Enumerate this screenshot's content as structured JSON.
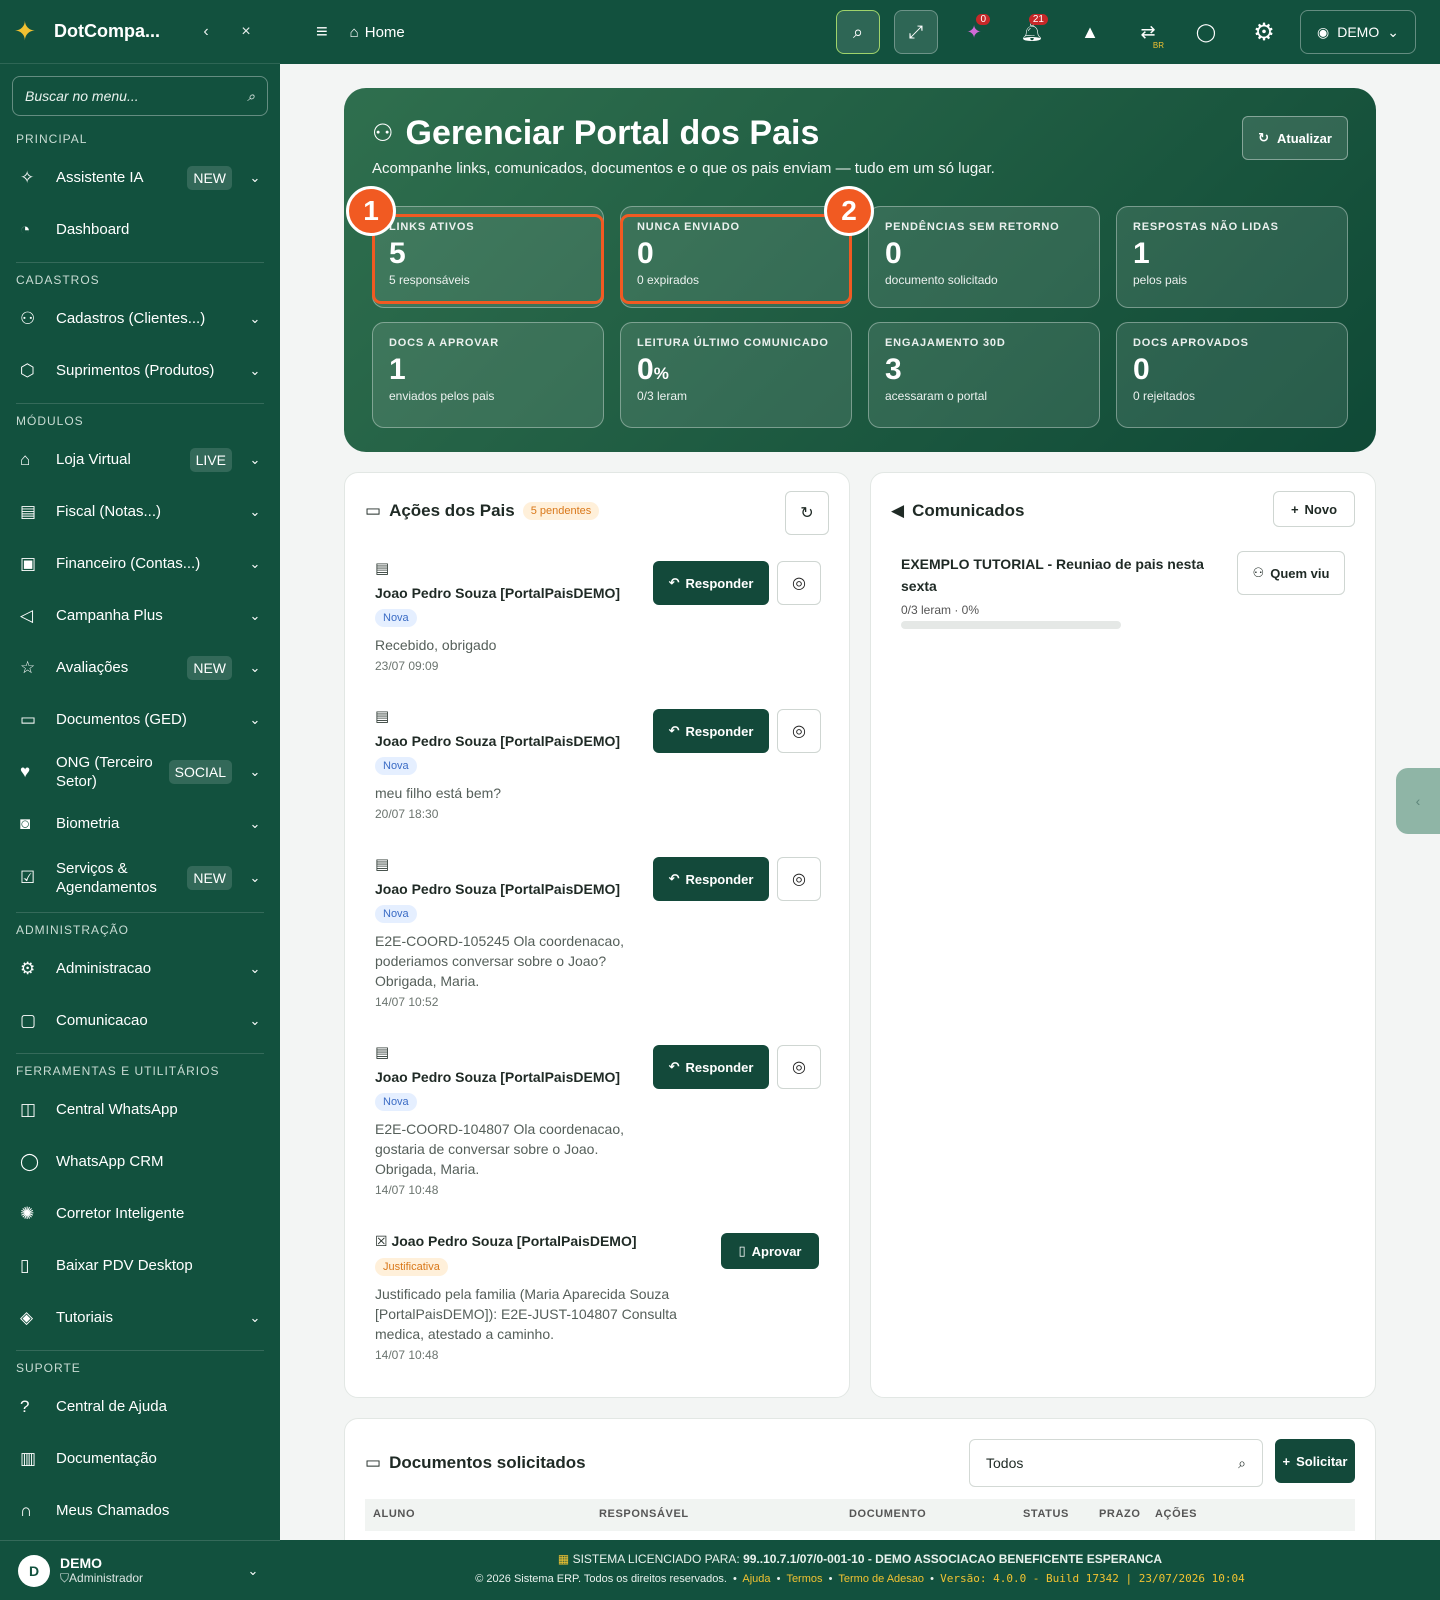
{
  "sidebar": {
    "brand": "DotCompa...",
    "search_placeholder": "Buscar no menu...",
    "sections": {
      "principal": "PRINCIPAL",
      "cadastros": "CADASTROS",
      "modulos": "MÓDULOS",
      "admin": "ADMINISTRAÇÃO",
      "ferramentas": "FERRAMENTAS E UTILITÁRIOS",
      "suporte": "SUPORTE"
    },
    "items": {
      "assistente": {
        "label": "Assistente IA",
        "badge": "NEW"
      },
      "dashboard": {
        "label": "Dashboard"
      },
      "cadastros": {
        "label": "Cadastros (Clientes...)"
      },
      "suprimentos": {
        "label": "Suprimentos (Produtos)"
      },
      "loja": {
        "label": "Loja Virtual",
        "badge": "LIVE"
      },
      "fiscal": {
        "label": "Fiscal (Notas...)"
      },
      "financeiro": {
        "label": "Financeiro (Contas...)"
      },
      "campanha": {
        "label": "Campanha Plus"
      },
      "avaliacoes": {
        "label": "Avaliações",
        "badge": "NEW"
      },
      "documentos": {
        "label": "Documentos (GED)"
      },
      "ong": {
        "label": "ONG (Terceiro Setor)",
        "badge": "SOCIAL"
      },
      "biometria": {
        "label": "Biometria"
      },
      "servicos": {
        "label": "Serviços & Agendamentos",
        "badge": "NEW"
      },
      "administracao": {
        "label": "Administracao"
      },
      "comunicacao": {
        "label": "Comunicacao"
      },
      "central_whatsapp": {
        "label": "Central WhatsApp"
      },
      "whatsapp_crm": {
        "label": "WhatsApp CRM"
      },
      "corretor": {
        "label": "Corretor Inteligente"
      },
      "pdv": {
        "label": "Baixar PDV Desktop"
      },
      "tutoriais": {
        "label": "Tutoriais"
      },
      "ajuda": {
        "label": "Central de Ajuda"
      },
      "documentacao": {
        "label": "Documentação"
      },
      "chamados": {
        "label": "Meus Chamados"
      }
    },
    "user": {
      "initial": "D",
      "name": "DEMO",
      "role": "Administrador"
    }
  },
  "topbar": {
    "home": "Home",
    "ai_count": "0",
    "notif_count": "21",
    "lang_badge": "BR",
    "user": "DEMO"
  },
  "hero": {
    "title": "Gerenciar Portal dos Pais",
    "subtitle": "Acompanhe links, comunicados, documentos e o que os pais enviam — tudo em um só lugar.",
    "refresh": "Atualizar",
    "stats": [
      {
        "label": "LINKS ATIVOS",
        "value": "5",
        "sub": "5 responsáveis"
      },
      {
        "label": "NUNCA ENVIADO",
        "value": "0",
        "sub": "0 expirados"
      },
      {
        "label": "PENDÊNCIAS SEM RETORNO",
        "value": "0",
        "sub": "documento solicitado"
      },
      {
        "label": "RESPOSTAS NÃO LIDAS",
        "value": "1",
        "sub": "pelos pais"
      },
      {
        "label": "DOCS A APROVAR",
        "value": "1",
        "sub": "enviados pelos pais"
      },
      {
        "label": "LEITURA ÚLTIMO COMUNICADO",
        "value": "0",
        "unit": "%",
        "sub": "0/3 leram"
      },
      {
        "label": "ENGAJAMENTO 30D",
        "value": "3",
        "sub": "acessaram o portal"
      },
      {
        "label": "DOCS APROVADOS",
        "value": "0",
        "sub": "0 rejeitados"
      }
    ],
    "markers": [
      "1",
      "2"
    ]
  },
  "acoes": {
    "title": "Ações dos Pais",
    "pending": "5 pendentes",
    "reply": "Responder",
    "approve": "Aprovar",
    "items": [
      {
        "name": "Joao Pedro Souza [PortalPaisDEMO]",
        "tag": "Nova",
        "msg": "Recebido, obrigado",
        "date": "23/07 09:09"
      },
      {
        "name": "Joao Pedro Souza [PortalPaisDEMO]",
        "tag": "Nova",
        "msg": "meu filho está bem?",
        "date": "20/07 18:30"
      },
      {
        "name": "Joao Pedro Souza [PortalPaisDEMO]",
        "tag": "Nova",
        "msg": "E2E-COORD-105245 Ola coordenacao, poderiamos conversar sobre o Joao? Obrigada, Maria.",
        "date": "14/07 10:52"
      },
      {
        "name": "Joao Pedro Souza [PortalPaisDEMO]",
        "tag": "Nova",
        "msg": "E2E-COORD-104807 Ola coordenacao, gostaria de conversar sobre o Joao. Obrigada, Maria.",
        "date": "14/07 10:48"
      },
      {
        "name": "Joao Pedro Souza [PortalPaisDEMO]",
        "tag": "Justificativa",
        "msg": "Justificado pela familia (Maria Aparecida Souza [PortalPaisDEMO]): E2E-JUST-104807 Consulta medica, atestado a caminho.",
        "date": "14/07 10:48"
      }
    ]
  },
  "comunicados": {
    "title": "Comunicados",
    "new": "Novo",
    "item": {
      "title": "EXEMPLO TUTORIAL - Reuniao de pais nesta sexta",
      "meta": "0/3 leram · 0%",
      "who": "Quem viu",
      "progress": 0
    }
  },
  "documentos": {
    "title": "Documentos solicitados",
    "filter": "Todos",
    "request": "Solicitar",
    "columns": [
      "ALUNO",
      "RESPONSÁVEL",
      "DOCUMENTO",
      "STATUS",
      "PRAZO",
      "AÇÕES"
    ]
  },
  "footer": {
    "license_label": "SISTEMA LICENCIADO PARA:",
    "license": "99..10.7.1/07/0-001-10 - DEMO ASSOCIACAO BENEFICENTE ESPERANCA",
    "copyright": "© 2026 Sistema ERP. Todos os direitos reservados.",
    "links": [
      "Ajuda",
      "Termos",
      "Termo de Adesao"
    ],
    "version": "Versão: 4.0.0 - Build 17342 | 23/07/2026 10:04"
  },
  "colors": {
    "primary": "#12513e",
    "accent": "#f15a22",
    "button": "#13493a"
  }
}
